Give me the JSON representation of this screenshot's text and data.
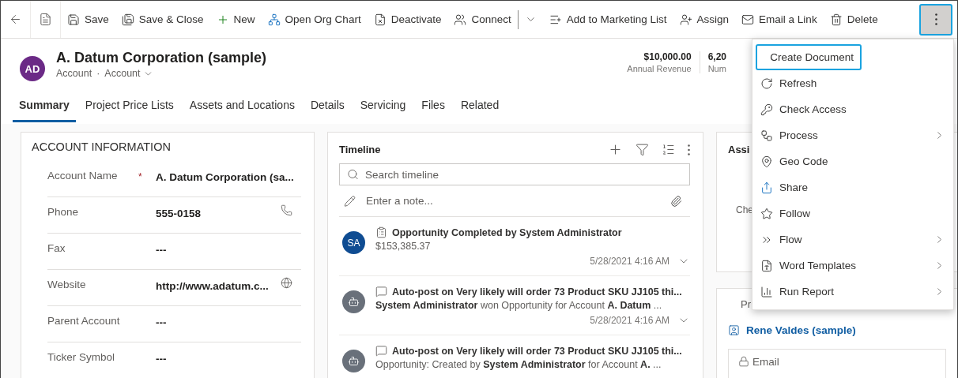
{
  "toolbar": {
    "items": [
      {
        "label": "Save"
      },
      {
        "label": "Save & Close"
      },
      {
        "label": "New"
      },
      {
        "label": "Open Org Chart"
      },
      {
        "label": "Deactivate"
      },
      {
        "label": "Connect",
        "split": true
      },
      {
        "label": "Add to Marketing List"
      },
      {
        "label": "Assign"
      },
      {
        "label": "Email a Link"
      },
      {
        "label": "Delete"
      }
    ],
    "more": {
      "expanded": true
    }
  },
  "record": {
    "initials": "AD",
    "title": "A. Datum Corporation (sample)",
    "entity": "Account",
    "separator": "·",
    "form": "Account",
    "stats": [
      {
        "value": "$10,000.00",
        "label": "Annual Revenue"
      },
      {
        "value": "6,20",
        "label": "Num"
      }
    ]
  },
  "tabs": [
    {
      "label": "Summary",
      "selected": true
    },
    {
      "label": "Project Price Lists",
      "selected": false
    },
    {
      "label": "Assets and Locations",
      "selected": false
    },
    {
      "label": "Details",
      "selected": false
    },
    {
      "label": "Servicing",
      "selected": false
    },
    {
      "label": "Files",
      "selected": false
    },
    {
      "label": "Related",
      "selected": false
    }
  ],
  "account_information": {
    "title": "ACCOUNT INFORMATION",
    "fields": [
      {
        "label": "Account Name",
        "required_mark": "*",
        "value": "A. Datum Corporation (sa...",
        "kind": "text"
      },
      {
        "label": "Phone",
        "value": "555-0158",
        "kind": "phone"
      },
      {
        "label": "Fax",
        "value": "---",
        "kind": "text"
      },
      {
        "label": "Website",
        "value": "http://www.adatum.c...",
        "kind": "url"
      },
      {
        "label": "Parent Account",
        "value": "---",
        "kind": "text"
      },
      {
        "label": "Ticker Symbol",
        "value": "---",
        "kind": "text"
      }
    ]
  },
  "timeline": {
    "title": "Timeline",
    "search": {
      "placeholder": "Search timeline"
    },
    "note": {
      "placeholder": "Enter a note..."
    },
    "entries": [
      {
        "kind": "person",
        "initials": "SA",
        "color": "#0f4c92",
        "title": "Opportunity Completed by System Administrator",
        "body": "$153,385.37",
        "date": "5/28/2021 4:16 AM"
      },
      {
        "kind": "bot",
        "title": "Auto-post on Very likely will order 73 Product SKU JJ105 thi...",
        "body": "**System Administrator** won Opportunity for Account **A. Datum** ...",
        "date": "5/28/2021 4:16 AM"
      },
      {
        "kind": "bot",
        "title": "Auto-post on Very likely will order 73 Product SKU JJ105 thi...",
        "body": "Opportunity: Created by **System Administrator** for Account **A.** ..."
      }
    ]
  },
  "side": {
    "card_1": {
      "heading": "Assi",
      "text": "Che"
    },
    "card_2": {
      "label": "Pr",
      "link": "Rene Valdes (sample)",
      "email_label": "Email"
    }
  },
  "menu": {
    "items": [
      {
        "label": "Create Document",
        "submenu": false,
        "focused": true
      },
      {
        "label": "Refresh",
        "submenu": false,
        "focused": false
      },
      {
        "label": "Check Access",
        "submenu": false,
        "focused": false
      },
      {
        "label": "Process",
        "submenu": true,
        "focused": false
      },
      {
        "label": "Geo Code",
        "submenu": false,
        "focused": false
      },
      {
        "label": "Share",
        "submenu": false,
        "focused": false
      },
      {
        "label": "Follow",
        "submenu": false,
        "focused": false
      },
      {
        "label": "Flow",
        "submenu": true,
        "focused": false
      },
      {
        "label": "Word Templates",
        "submenu": true,
        "focused": false
      },
      {
        "label": "Run Report",
        "submenu": true,
        "focused": false
      }
    ]
  }
}
